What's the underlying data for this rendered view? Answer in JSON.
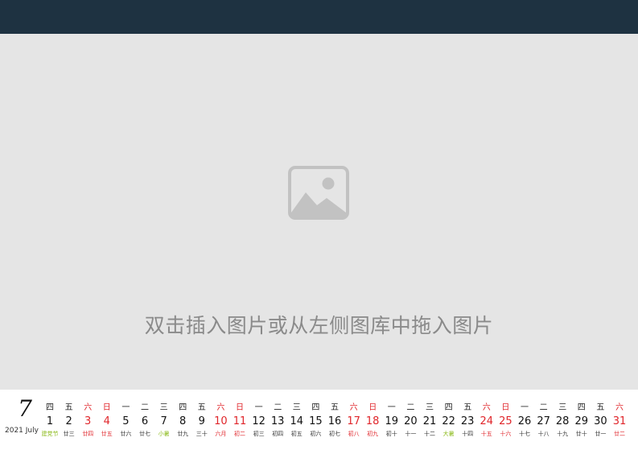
{
  "placeholder": {
    "icon": "image-icon",
    "text": "双击插入图片或从左侧图库中拖入图片"
  },
  "calendar": {
    "month_number": "7",
    "month_label": "2021 July",
    "accent_red": "#e0262b",
    "accent_green": "#8dbb1e",
    "days": [
      {
        "weekday": "四",
        "day": "1",
        "lunar": "建党节",
        "weekend": false,
        "festival": true
      },
      {
        "weekday": "五",
        "day": "2",
        "lunar": "廿三",
        "weekend": false,
        "festival": false
      },
      {
        "weekday": "六",
        "day": "3",
        "lunar": "廿四",
        "weekend": true,
        "festival": false
      },
      {
        "weekday": "日",
        "day": "4",
        "lunar": "廿五",
        "weekend": true,
        "festival": false
      },
      {
        "weekday": "一",
        "day": "5",
        "lunar": "廿六",
        "weekend": false,
        "festival": false
      },
      {
        "weekday": "二",
        "day": "6",
        "lunar": "廿七",
        "weekend": false,
        "festival": false
      },
      {
        "weekday": "三",
        "day": "7",
        "lunar": "小暑",
        "weekend": false,
        "festival": true
      },
      {
        "weekday": "四",
        "day": "8",
        "lunar": "廿九",
        "weekend": false,
        "festival": false
      },
      {
        "weekday": "五",
        "day": "9",
        "lunar": "三十",
        "weekend": false,
        "festival": false
      },
      {
        "weekday": "六",
        "day": "10",
        "lunar": "六月",
        "weekend": true,
        "festival": false
      },
      {
        "weekday": "日",
        "day": "11",
        "lunar": "初二",
        "weekend": true,
        "festival": false
      },
      {
        "weekday": "一",
        "day": "12",
        "lunar": "初三",
        "weekend": false,
        "festival": false
      },
      {
        "weekday": "二",
        "day": "13",
        "lunar": "初四",
        "weekend": false,
        "festival": false
      },
      {
        "weekday": "三",
        "day": "14",
        "lunar": "初五",
        "weekend": false,
        "festival": false
      },
      {
        "weekday": "四",
        "day": "15",
        "lunar": "初六",
        "weekend": false,
        "festival": false
      },
      {
        "weekday": "五",
        "day": "16",
        "lunar": "初七",
        "weekend": false,
        "festival": false
      },
      {
        "weekday": "六",
        "day": "17",
        "lunar": "初八",
        "weekend": true,
        "festival": false
      },
      {
        "weekday": "日",
        "day": "18",
        "lunar": "初九",
        "weekend": true,
        "festival": false
      },
      {
        "weekday": "一",
        "day": "19",
        "lunar": "初十",
        "weekend": false,
        "festival": false
      },
      {
        "weekday": "二",
        "day": "20",
        "lunar": "十一",
        "weekend": false,
        "festival": false
      },
      {
        "weekday": "三",
        "day": "21",
        "lunar": "十二",
        "weekend": false,
        "festival": false
      },
      {
        "weekday": "四",
        "day": "22",
        "lunar": "大暑",
        "weekend": false,
        "festival": true
      },
      {
        "weekday": "五",
        "day": "23",
        "lunar": "十四",
        "weekend": false,
        "festival": false
      },
      {
        "weekday": "六",
        "day": "24",
        "lunar": "十五",
        "weekend": true,
        "festival": false
      },
      {
        "weekday": "日",
        "day": "25",
        "lunar": "十六",
        "weekend": true,
        "festival": false
      },
      {
        "weekday": "一",
        "day": "26",
        "lunar": "十七",
        "weekend": false,
        "festival": false
      },
      {
        "weekday": "二",
        "day": "27",
        "lunar": "十八",
        "weekend": false,
        "festival": false
      },
      {
        "weekday": "三",
        "day": "28",
        "lunar": "十九",
        "weekend": false,
        "festival": false
      },
      {
        "weekday": "四",
        "day": "29",
        "lunar": "廿十",
        "weekend": false,
        "festival": false
      },
      {
        "weekday": "五",
        "day": "30",
        "lunar": "廿一",
        "weekend": false,
        "festival": false
      },
      {
        "weekday": "六",
        "day": "31",
        "lunar": "廿二",
        "weekend": true,
        "festival": false
      }
    ]
  }
}
